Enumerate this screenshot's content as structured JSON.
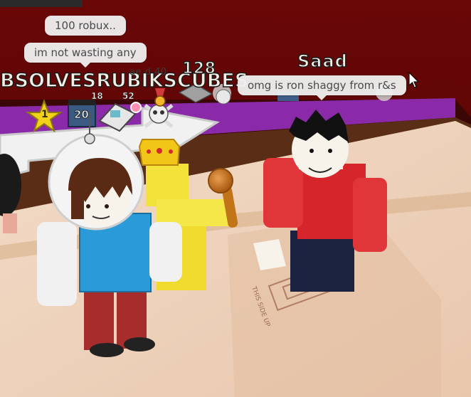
{
  "chat_bubbles": {
    "top": "100 robux..",
    "middle": "im not wasting any",
    "right": "omg is ron shaggy from r&s"
  },
  "nametags": {
    "left_player": "BSOLVESRUBIKSCUBES",
    "right_player": "Saad",
    "behind_left_fragment": "ae d 40",
    "behind_right_fragment": "128"
  },
  "badge_counts": {
    "star": "1",
    "film": "20",
    "ticket": "52",
    "arrow": "18"
  },
  "marking": "THIS SIDE UP",
  "colors": {
    "wall": "#640606",
    "floor": "#efd6c0",
    "trim": "#8a2aa8",
    "shirt_red": "#d6262c",
    "shirt_blue": "#2b9ad8",
    "yellow": "#f3e23a"
  }
}
